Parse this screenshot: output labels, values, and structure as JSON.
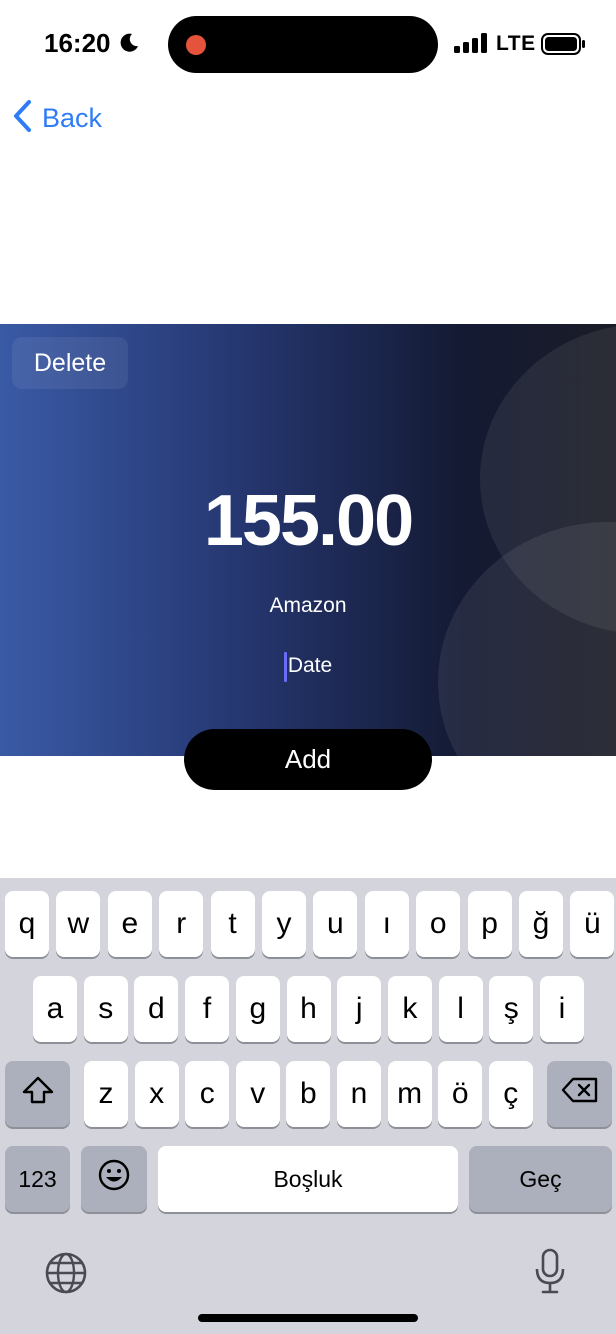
{
  "status_bar": {
    "time": "16:20",
    "network": "LTE"
  },
  "nav": {
    "back_label": "Back"
  },
  "card": {
    "delete_label": "Delete",
    "amount": "155.00",
    "merchant": "Amazon",
    "date_placeholder": "Date"
  },
  "add_label": "Add",
  "keyboard": {
    "row1": [
      "q",
      "w",
      "e",
      "r",
      "t",
      "y",
      "u",
      "ı",
      "o",
      "p",
      "ğ",
      "ü"
    ],
    "row2": [
      "a",
      "s",
      "d",
      "f",
      "g",
      "h",
      "j",
      "k",
      "l",
      "ş",
      "i"
    ],
    "row3": [
      "z",
      "x",
      "c",
      "v",
      "b",
      "n",
      "m",
      "ö",
      "ç"
    ],
    "numbers_label": "123",
    "space_label": "Boşluk",
    "return_label": "Geç"
  },
  "colors": {
    "link": "#2f7cf6",
    "record_dot": "#e5533a",
    "caret": "#6b6cf5"
  }
}
